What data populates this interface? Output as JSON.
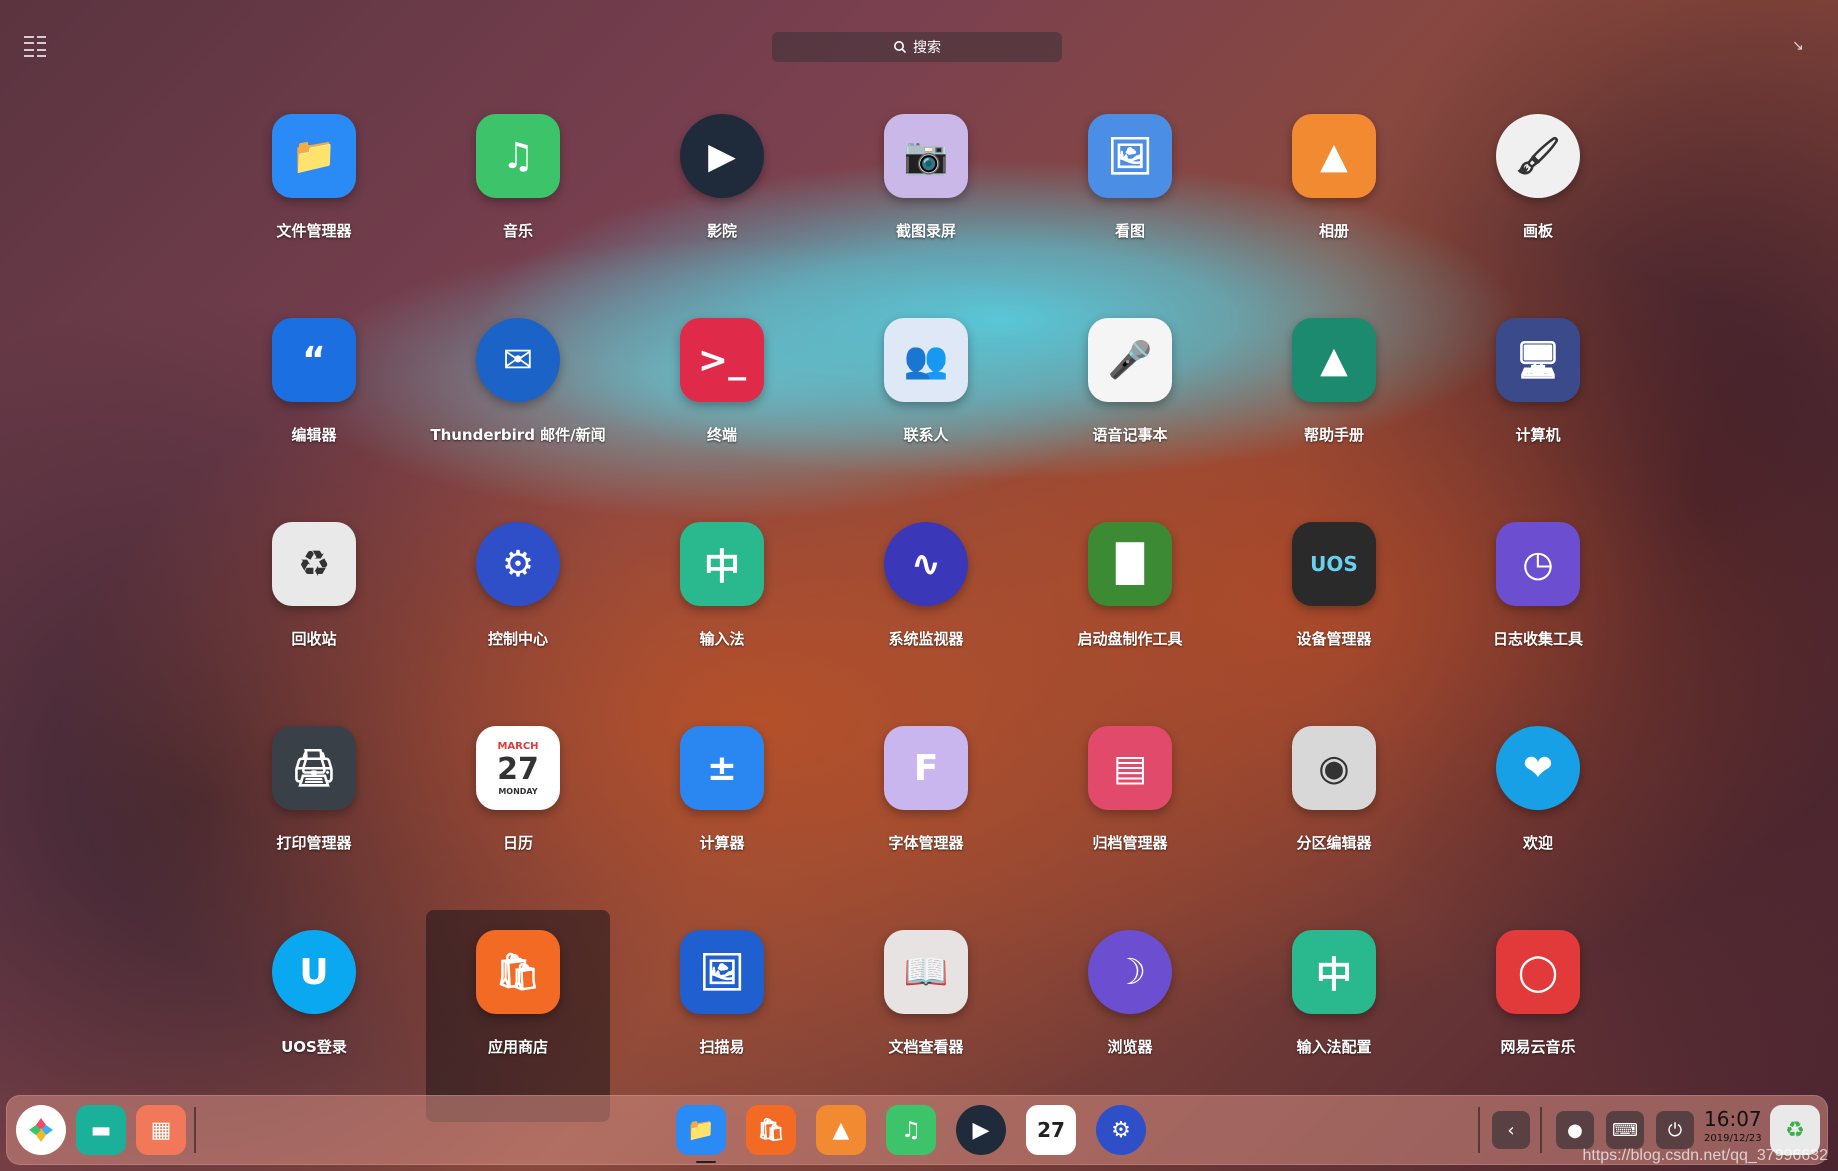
{
  "search": {
    "placeholder": "搜索"
  },
  "apps": [
    {
      "name": "文件管理器",
      "icon": "folder-icon",
      "color": "#2a8af6"
    },
    {
      "name": "音乐",
      "icon": "music-note-icon",
      "color": "#3dc36a"
    },
    {
      "name": "影院",
      "icon": "play-icon",
      "color": "#1f2b3a"
    },
    {
      "name": "截图录屏",
      "icon": "camera-icon",
      "color": "#c9b8e8"
    },
    {
      "name": "看图",
      "icon": "image-viewer-icon",
      "color": "#4a8ee6"
    },
    {
      "name": "相册",
      "icon": "photo-album-icon",
      "color": "#f28a32"
    },
    {
      "name": "画板",
      "icon": "paint-brush-icon",
      "color": "#f0f0f0"
    },
    {
      "name": "编辑器",
      "icon": "quote-icon",
      "color": "#1c6fe0"
    },
    {
      "name": "Thunderbird 邮件/新闻",
      "icon": "thunderbird-icon",
      "color": "#1b63c6"
    },
    {
      "name": "终端",
      "icon": "terminal-icon",
      "color": "#e02a4a"
    },
    {
      "name": "联系人",
      "icon": "contacts-icon",
      "color": "#dfe8f6"
    },
    {
      "name": "语音记事本",
      "icon": "microphone-icon",
      "color": "#f5f5f5"
    },
    {
      "name": "帮助手册",
      "icon": "lighthouse-icon",
      "color": "#1c8a6e"
    },
    {
      "name": "计算机",
      "icon": "monitor-icon",
      "color": "#3a4a8a"
    },
    {
      "name": "回收站",
      "icon": "trash-icon",
      "color": "#e9e9e9"
    },
    {
      "name": "控制中心",
      "icon": "gear-icon",
      "color": "#2f4fc9"
    },
    {
      "name": "输入法",
      "icon": "keyboard-icon",
      "color": "#2ab88f"
    },
    {
      "name": "系统监视器",
      "icon": "cpu-wave-icon",
      "color": "#3a38b8"
    },
    {
      "name": "启动盘制作工具",
      "icon": "usb-drive-icon",
      "color": "#3c8a34"
    },
    {
      "name": "设备管理器",
      "icon": "chip-icon",
      "color": "#2a2a2a"
    },
    {
      "name": "日志收集工具",
      "icon": "log-clock-icon",
      "color": "#6b4fd0"
    },
    {
      "name": "打印管理器",
      "icon": "printer-icon",
      "color": "#3a4048"
    },
    {
      "name": "日历",
      "icon": "calendar-icon",
      "color": "#ffffff"
    },
    {
      "name": "计算器",
      "icon": "calculator-icon",
      "color": "#2a86f0"
    },
    {
      "name": "字体管理器",
      "icon": "font-icon",
      "color": "#c9b6ee"
    },
    {
      "name": "归档管理器",
      "icon": "archive-icon",
      "color": "#e14a6a"
    },
    {
      "name": "分区编辑器",
      "icon": "harddisk-icon",
      "color": "#d8d8d8"
    },
    {
      "name": "欢迎",
      "icon": "handshake-icon",
      "color": "#18a0e6"
    },
    {
      "name": "UOS登录",
      "icon": "uos-login-icon",
      "color": "#0aa8f0"
    },
    {
      "name": "应用商店",
      "icon": "shopping-bag-icon",
      "color": "#f26a24"
    },
    {
      "name": "扫描易",
      "icon": "scanner-icon",
      "color": "#1f5fd0"
    },
    {
      "name": "文档查看器",
      "icon": "document-viewer-icon",
      "color": "#e8e3e3"
    },
    {
      "name": "浏览器",
      "icon": "browser-icon",
      "color": "#6b4fd0"
    },
    {
      "name": "输入法配置",
      "icon": "keyboard-config-icon",
      "color": "#2ab88f"
    },
    {
      "name": "网易云音乐",
      "icon": "netease-music-icon",
      "color": "#e23a3a"
    }
  ],
  "calendar_icon": {
    "month": "MARCH",
    "day": "27",
    "weekday": "MONDAY"
  },
  "device_icon_text": "UOS",
  "dock": {
    "left": [
      "launcher-icon",
      "multitask-icon",
      "workspace-icon"
    ],
    "apps": [
      "folder-icon",
      "shopping-bag-icon",
      "photo-album-icon",
      "music-note-icon",
      "play-icon",
      "calendar-icon",
      "gear-icon"
    ],
    "tray": [
      "chevron-left-icon",
      "network-icon",
      "keyboard-icon",
      "power-icon"
    ],
    "clock_time": "16:07",
    "clock_date": "2019/12/23"
  },
  "watermark": "https://blog.csdn.net/qq_37996632"
}
